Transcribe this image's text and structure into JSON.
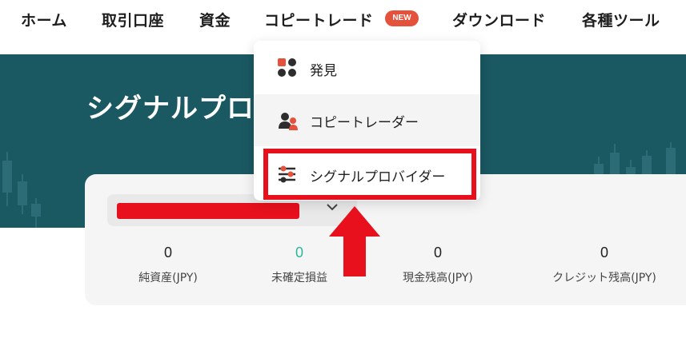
{
  "nav": {
    "home": "ホーム",
    "trading_account": "取引口座",
    "funds": "資金",
    "copy_trade": "コピートレード",
    "new_badge": "NEW",
    "download": "ダウンロード",
    "tools": "各種ツール"
  },
  "hero": {
    "title": "シグナルプロ"
  },
  "dropdown": {
    "items": [
      {
        "label": "発見",
        "icon": "discover-grid-icon"
      },
      {
        "label": "コピートレーダー",
        "icon": "copy-trader-users-icon"
      },
      {
        "label": "シグナルプロバイダー",
        "icon": "signal-provider-sliders-icon"
      }
    ]
  },
  "account": {
    "selected_value": "",
    "stats": [
      {
        "value": "0",
        "label": "純資産(JPY)"
      },
      {
        "value": "0",
        "label": "未確定損益"
      },
      {
        "value": "0",
        "label": "現金残高(JPY)"
      },
      {
        "value": "0",
        "label": "クレジット残高(JPY)"
      }
    ]
  },
  "colors": {
    "hero_bg": "#1a5862",
    "accent_orange": "#e4523c",
    "profit_green": "#2bb89a",
    "annotation_red": "#e8101d"
  }
}
